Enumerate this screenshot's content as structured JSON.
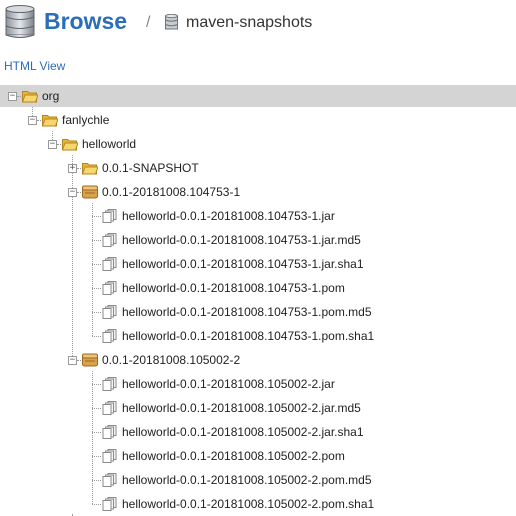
{
  "header": {
    "title": "Browse",
    "separator": "/",
    "repository": "maven-snapshots"
  },
  "links": {
    "html_view": "HTML View"
  },
  "tree": [
    {
      "label": "org",
      "type": "folder",
      "level": 0,
      "toggle": "−",
      "selected": true
    },
    {
      "label": "fanlychle",
      "type": "folder",
      "level": 1,
      "toggle": "−"
    },
    {
      "label": "helloworld",
      "type": "folder",
      "level": 2,
      "toggle": "−"
    },
    {
      "label": "0.0.1-SNAPSHOT",
      "type": "folder",
      "level": 3,
      "toggle": "+"
    },
    {
      "label": "0.0.1-20181008.104753-1",
      "type": "component",
      "level": 3,
      "toggle": "−"
    },
    {
      "label": "helloworld-0.0.1-20181008.104753-1.jar",
      "type": "asset",
      "level": 4
    },
    {
      "label": "helloworld-0.0.1-20181008.104753-1.jar.md5",
      "type": "asset",
      "level": 4
    },
    {
      "label": "helloworld-0.0.1-20181008.104753-1.jar.sha1",
      "type": "asset",
      "level": 4
    },
    {
      "label": "helloworld-0.0.1-20181008.104753-1.pom",
      "type": "asset",
      "level": 4
    },
    {
      "label": "helloworld-0.0.1-20181008.104753-1.pom.md5",
      "type": "asset",
      "level": 4
    },
    {
      "label": "helloworld-0.0.1-20181008.104753-1.pom.sha1",
      "type": "asset",
      "level": 4
    },
    {
      "label": "0.0.1-20181008.105002-2",
      "type": "component",
      "level": 3,
      "toggle": "−"
    },
    {
      "label": "helloworld-0.0.1-20181008.105002-2.jar",
      "type": "asset",
      "level": 4
    },
    {
      "label": "helloworld-0.0.1-20181008.105002-2.jar.md5",
      "type": "asset",
      "level": 4
    },
    {
      "label": "helloworld-0.0.1-20181008.105002-2.jar.sha1",
      "type": "asset",
      "level": 4
    },
    {
      "label": "helloworld-0.0.1-20181008.105002-2.pom",
      "type": "asset",
      "level": 4
    },
    {
      "label": "helloworld-0.0.1-20181008.105002-2.pom.md5",
      "type": "asset",
      "level": 4
    },
    {
      "label": "helloworld-0.0.1-20181008.105002-2.pom.sha1",
      "type": "asset",
      "level": 4
    }
  ],
  "icons": {
    "browse": "database-icon",
    "repository": "database-icon",
    "folder": "folder-open-icon",
    "folder_closed": "folder-icon",
    "component": "package-icon",
    "asset": "file-icon"
  },
  "colors": {
    "accent": "#2a6ebb",
    "selected_row": "#d4d4d4",
    "folder": "#f0c24a",
    "component": "#d9a14a"
  }
}
